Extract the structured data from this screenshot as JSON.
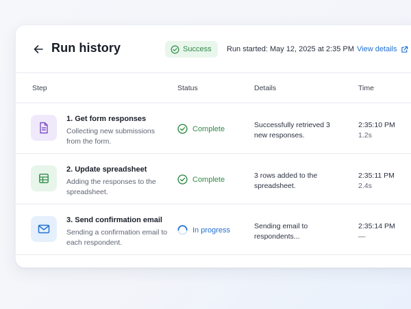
{
  "header": {
    "title": "Run history",
    "badge": "Success",
    "run_started": "Run started: May 12, 2025 at 2:35 PM",
    "view_details": "View details"
  },
  "columns": {
    "step": "Step",
    "status": "Status",
    "details": "Details",
    "time": "Time"
  },
  "rows": [
    {
      "title": "1. Get form responses",
      "desc": "Collecting new submissions from the form.",
      "status": "Complete",
      "details": "Successfully retrieved 3 new responses.",
      "time": "2:35:10 PM",
      "duration": "1.2s",
      "icon": "document-icon"
    },
    {
      "title": "2. Update spreadsheet",
      "desc": "Adding the responses to the spreadsheet.",
      "status": "Complete",
      "details": "3 rows added to the spreadsheet.",
      "time": "2:35:11 PM",
      "duration": "2.4s",
      "icon": "spreadsheet-icon"
    },
    {
      "title": "3. Send confirmation email",
      "desc": "Sending a confirmation email to each respondent.",
      "status": "In progress",
      "details": "Sending email to respondents...",
      "time": "2:35:14 PM",
      "duration": "—",
      "icon": "mail-icon"
    }
  ],
  "colors": {
    "accent": "#1f6fd1",
    "success": "#2f8a45",
    "success_bg": "#e9f6ec",
    "doc_icon_bg": "#efe9fb",
    "sheet_icon_bg": "#e7f5ea",
    "mail_icon_bg": "#e6f0fc"
  }
}
